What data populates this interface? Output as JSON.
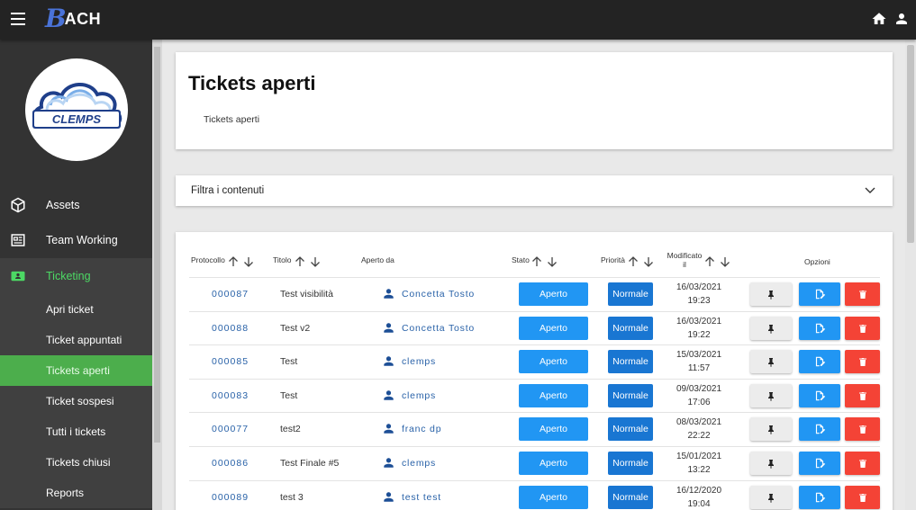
{
  "app": {
    "brand_initial": "B",
    "brand_rest": "ACH"
  },
  "colors": {
    "topbar": "#232323",
    "sidebar": "#333333",
    "accent_green": "#4cae4c",
    "primary": "#2196f3",
    "primary_dark": "#1976d2",
    "danger": "#f44336",
    "link": "#2962a8"
  },
  "topbar_icons": [
    "menu-icon",
    "home-icon",
    "user-icon"
  ],
  "sidebar": {
    "logo_text": "CLEMPS",
    "items": [
      {
        "label": "Assets",
        "icon": "cube-icon"
      },
      {
        "label": "Team Working",
        "icon": "newspaper-icon"
      },
      {
        "label": "Ticketing",
        "icon": "ticket-icon"
      }
    ],
    "subitems": [
      {
        "label": "Apri ticket"
      },
      {
        "label": "Ticket appuntati"
      },
      {
        "label": "Tickets aperti"
      },
      {
        "label": "Ticket sospesi"
      },
      {
        "label": "Tutti i tickets"
      },
      {
        "label": "Tickets chiusi"
      },
      {
        "label": "Reports"
      }
    ]
  },
  "main": {
    "title": "Tickets aperti",
    "breadcrumb": "Tickets aperti",
    "filter_label": "Filtra i contenuti"
  },
  "table": {
    "headers": {
      "protocollo": "Protocollo",
      "titolo": "Titolo",
      "aperto_da": "Aperto da",
      "stato": "Stato",
      "priorita": "Priorità",
      "modificato_1": "Modificato",
      "modificato_2": "il",
      "opzioni": "Opzioni"
    },
    "rows": [
      {
        "protocollo": "000087",
        "titolo": "Test visibilità",
        "aperto_da": "Concetta Tosto",
        "stato": "Aperto",
        "priorita": "Normale",
        "data": "16/03/2021",
        "ora": "19:23"
      },
      {
        "protocollo": "000088",
        "titolo": "Test v2",
        "aperto_da": "Concetta Tosto",
        "stato": "Aperto",
        "priorita": "Normale",
        "data": "16/03/2021",
        "ora": "19:22"
      },
      {
        "protocollo": "000085",
        "titolo": "Test",
        "aperto_da": "clemps",
        "stato": "Aperto",
        "priorita": "Normale",
        "data": "15/03/2021",
        "ora": "11:57"
      },
      {
        "protocollo": "000083",
        "titolo": "Test",
        "aperto_da": "clemps",
        "stato": "Aperto",
        "priorita": "Normale",
        "data": "09/03/2021",
        "ora": "17:06"
      },
      {
        "protocollo": "000077",
        "titolo": "test2",
        "aperto_da": "franc dp",
        "stato": "Aperto",
        "priorita": "Normale",
        "data": "08/03/2021",
        "ora": "22:22"
      },
      {
        "protocollo": "000086",
        "titolo": "Test Finale #5",
        "aperto_da": "clemps",
        "stato": "Aperto",
        "priorita": "Normale",
        "data": "15/01/2021",
        "ora": "13:22"
      },
      {
        "protocollo": "000089",
        "titolo": "test 3",
        "aperto_da": "test test",
        "stato": "Aperto",
        "priorita": "Normale",
        "data": "16/12/2020",
        "ora": "19:04"
      }
    ],
    "option_icons": [
      "pin-icon",
      "edit-icon",
      "trash-icon"
    ]
  }
}
